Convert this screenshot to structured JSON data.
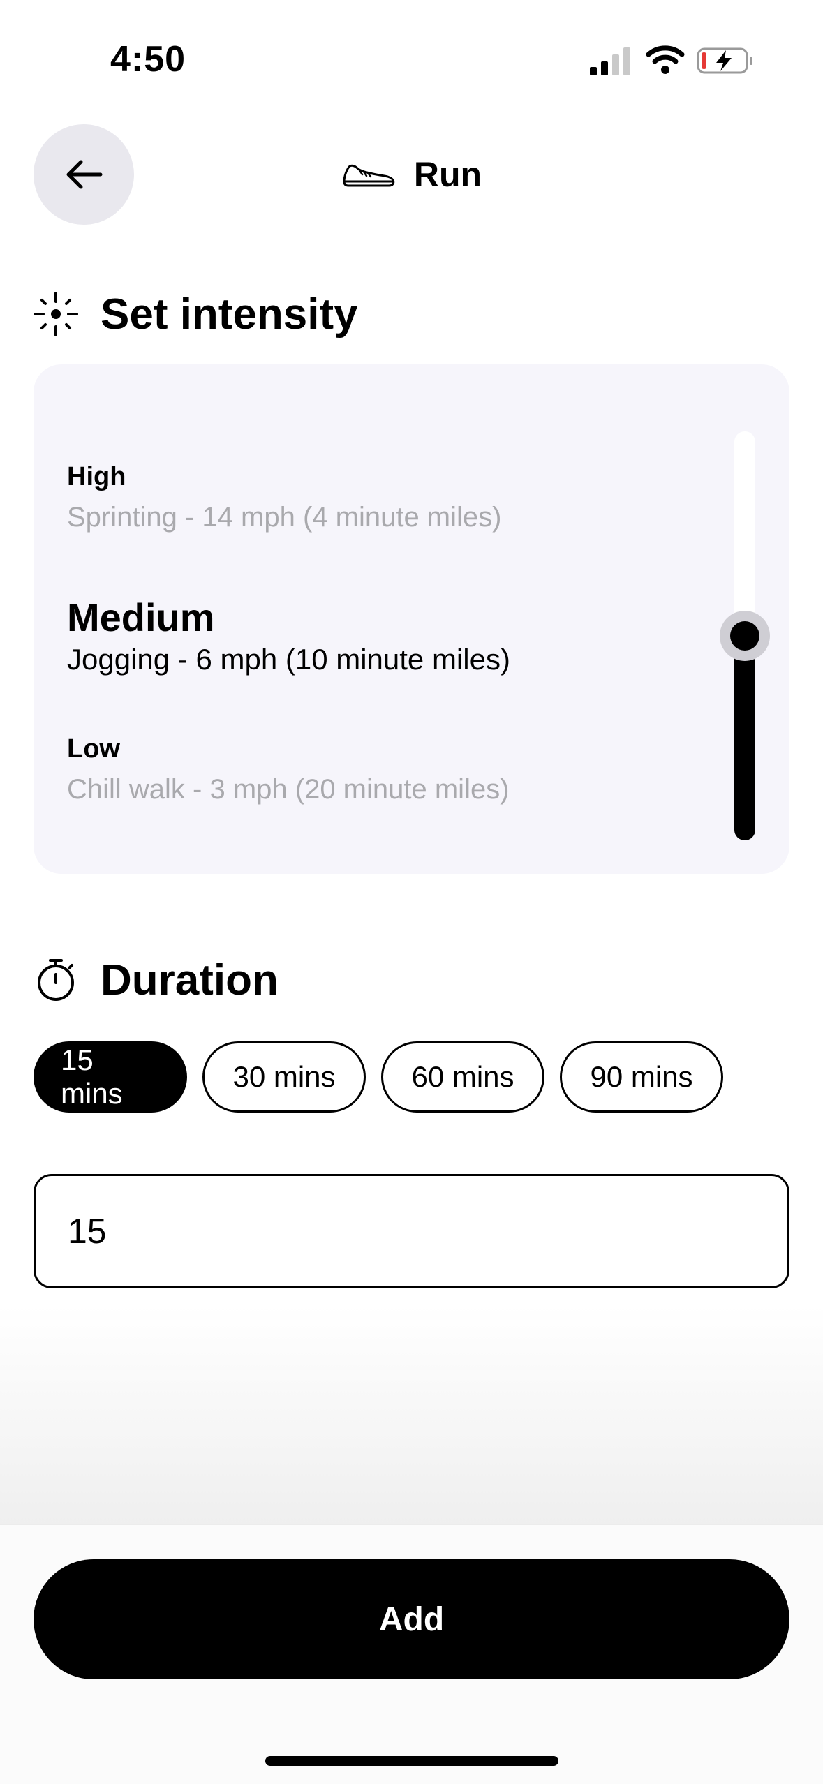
{
  "status_bar": {
    "time": "4:50",
    "icons": [
      "cellular-signal-icon",
      "wifi-icon",
      "battery-charging-icon"
    ]
  },
  "header": {
    "back_icon": "arrow-left-icon",
    "activity_icon": "running-shoe-icon",
    "title": "Run"
  },
  "intensity": {
    "heading": "Set intensity",
    "heading_icon": "sun-icon",
    "levels": [
      {
        "name": "High",
        "description": "Sprinting - 14 mph (4 minute miles)"
      },
      {
        "name": "Medium",
        "description": "Jogging - 6 mph (10 minute miles)"
      },
      {
        "name": "Low",
        "description": "Chill walk - 3 mph (20 minute miles)"
      }
    ],
    "selected_level": "Medium",
    "slider_level_fraction": 0.5
  },
  "duration": {
    "heading": "Duration",
    "heading_icon": "stopwatch-icon",
    "options": [
      "15 mins",
      "30 mins",
      "60 mins",
      "90 mins"
    ],
    "selected_option": "15 mins",
    "input_value": "15"
  },
  "actions": {
    "add_label": "Add"
  },
  "colors": {
    "accent": "#000000",
    "card_background": "#f6f5fb",
    "muted_text": "#a9a9ad",
    "back_button_bg": "#e9e8ee"
  }
}
